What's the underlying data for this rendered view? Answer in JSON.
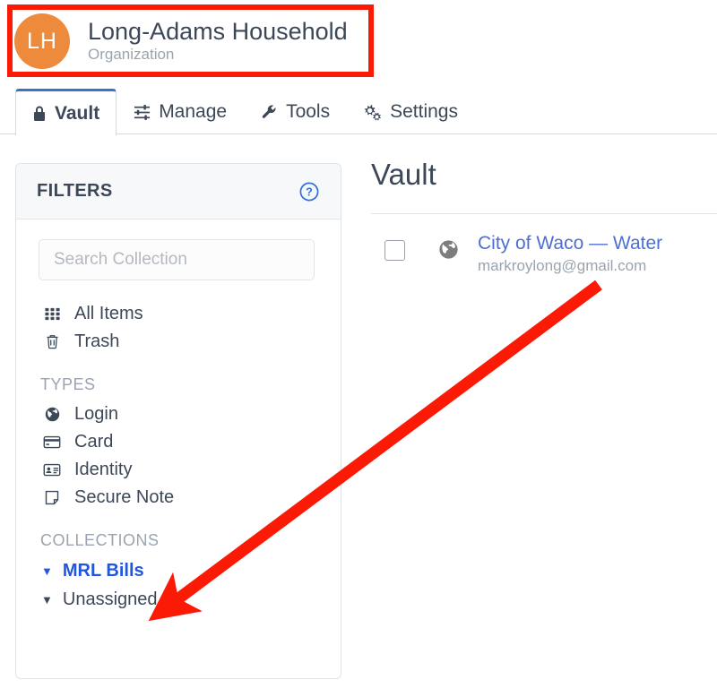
{
  "organization": {
    "initials": "LH",
    "name": "Long-Adams Household",
    "subtitle": "Organization",
    "avatar_color": "#ed8a3c"
  },
  "tabs": [
    {
      "label": "Vault",
      "icon": "lock-icon",
      "active": true
    },
    {
      "label": "Manage",
      "icon": "sliders-icon",
      "active": false
    },
    {
      "label": "Tools",
      "icon": "wrench-icon",
      "active": false
    },
    {
      "label": "Settings",
      "icon": "gears-icon",
      "active": false
    }
  ],
  "sidebar": {
    "title": "FILTERS",
    "help_icon": "question-circle-icon",
    "search": {
      "value": "",
      "placeholder": "Search Collection"
    },
    "nav_items": [
      {
        "label": "All Items",
        "icon": "grid-icon"
      },
      {
        "label": "Trash",
        "icon": "trash-icon"
      }
    ],
    "types_label": "TYPES",
    "types": [
      {
        "label": "Login",
        "icon": "globe-icon"
      },
      {
        "label": "Card",
        "icon": "credit-card-icon"
      },
      {
        "label": "Identity",
        "icon": "id-card-icon"
      },
      {
        "label": "Secure Note",
        "icon": "sticky-note-icon"
      }
    ],
    "collections_label": "COLLECTIONS",
    "collections": [
      {
        "label": "MRL Bills",
        "selected": true,
        "caret": "caret-down-icon"
      },
      {
        "label": "Unassigned",
        "selected": false,
        "caret": "caret-down-icon"
      }
    ]
  },
  "main": {
    "title": "Vault",
    "items": [
      {
        "name": "City of Waco — Water",
        "username": "markroylong@gmail.com",
        "type_icon": "globe-icon",
        "checked": false
      }
    ]
  },
  "annotations": {
    "highlight_color": "#fb1a06",
    "box_target": "organization-header",
    "arrow_from": "vault-item-city-of-waco",
    "arrow_to": "collection-mrl-bills"
  }
}
